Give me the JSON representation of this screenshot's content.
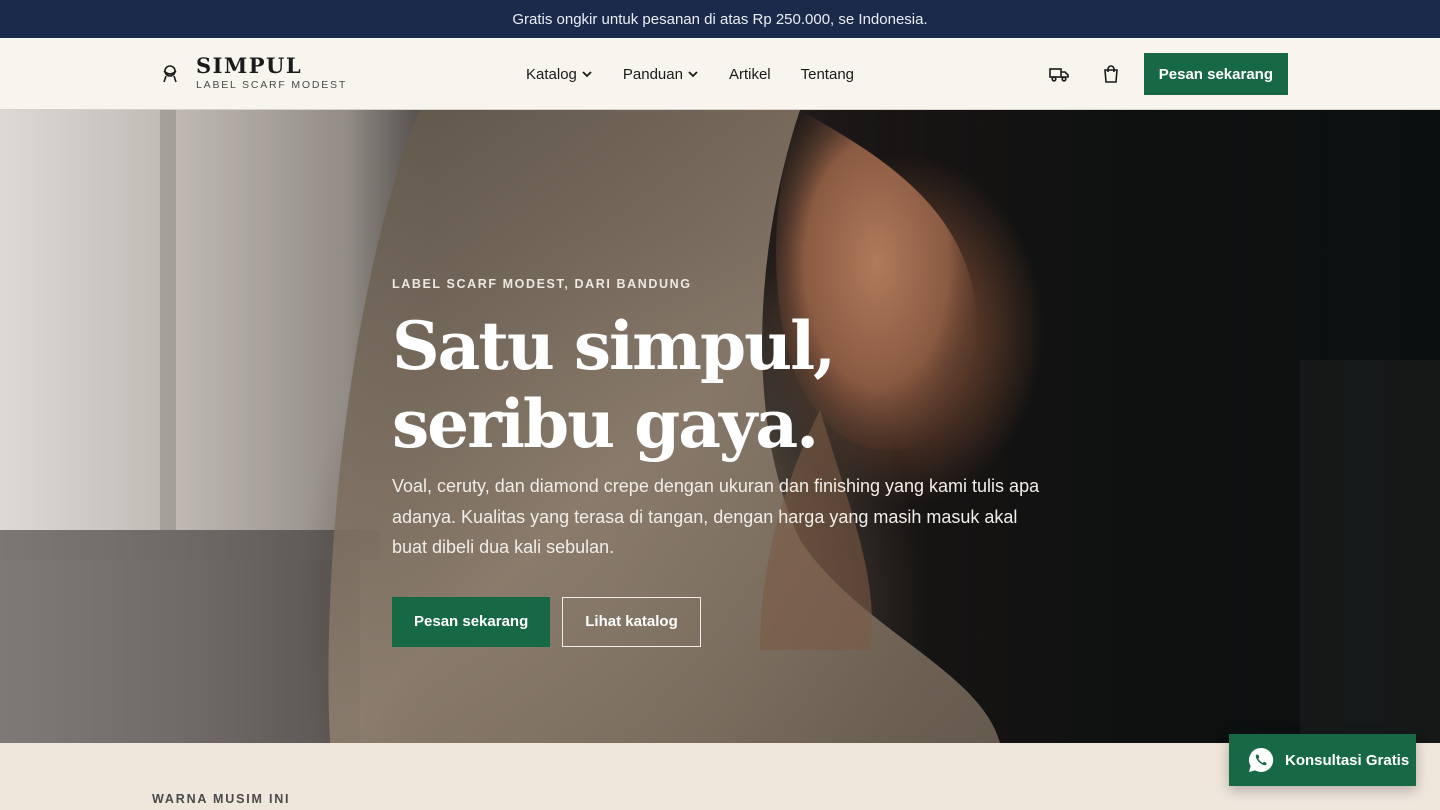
{
  "announcement": {
    "text": "Gratis ongkir untuk pesanan di atas Rp 250.000, se Indonesia."
  },
  "brand": {
    "name": "SIMPUL",
    "tagline": "LABEL SCARF MODEST",
    "logo_icon": "knot-logo-icon"
  },
  "nav": {
    "items": [
      {
        "label": "Katalog",
        "has_dropdown": true
      },
      {
        "label": "Panduan",
        "has_dropdown": true
      },
      {
        "label": "Artikel",
        "has_dropdown": false
      },
      {
        "label": "Tentang",
        "has_dropdown": false
      }
    ],
    "shipping_icon": "truck-icon",
    "cart_icon": "shopping-bag-icon",
    "cta_label": "Pesan sekarang"
  },
  "hero": {
    "eyebrow": "LABEL SCARF MODEST, DARI BANDUNG",
    "headline": "Satu simpul, seribu gaya.",
    "description": "Voal, ceruty, dan diamond crepe dengan ukuran dan finishing yang kami tulis apa adanya. Kualitas yang terasa di tangan, dengan harga yang masih masuk akal buat dibeli dua kali sebulan.",
    "primary_cta": "Pesan sekarang",
    "secondary_cta": "Lihat katalog"
  },
  "next_section": {
    "label": "WARNA MUSIM INI"
  },
  "whatsapp": {
    "label": "Konsultasi Gratis",
    "icon": "whatsapp-icon"
  },
  "colors": {
    "announcement_bg": "#1b2a4a",
    "nav_bg": "#f8f5ee",
    "accent_green": "#176844",
    "page_bg": "#efe6dc"
  }
}
